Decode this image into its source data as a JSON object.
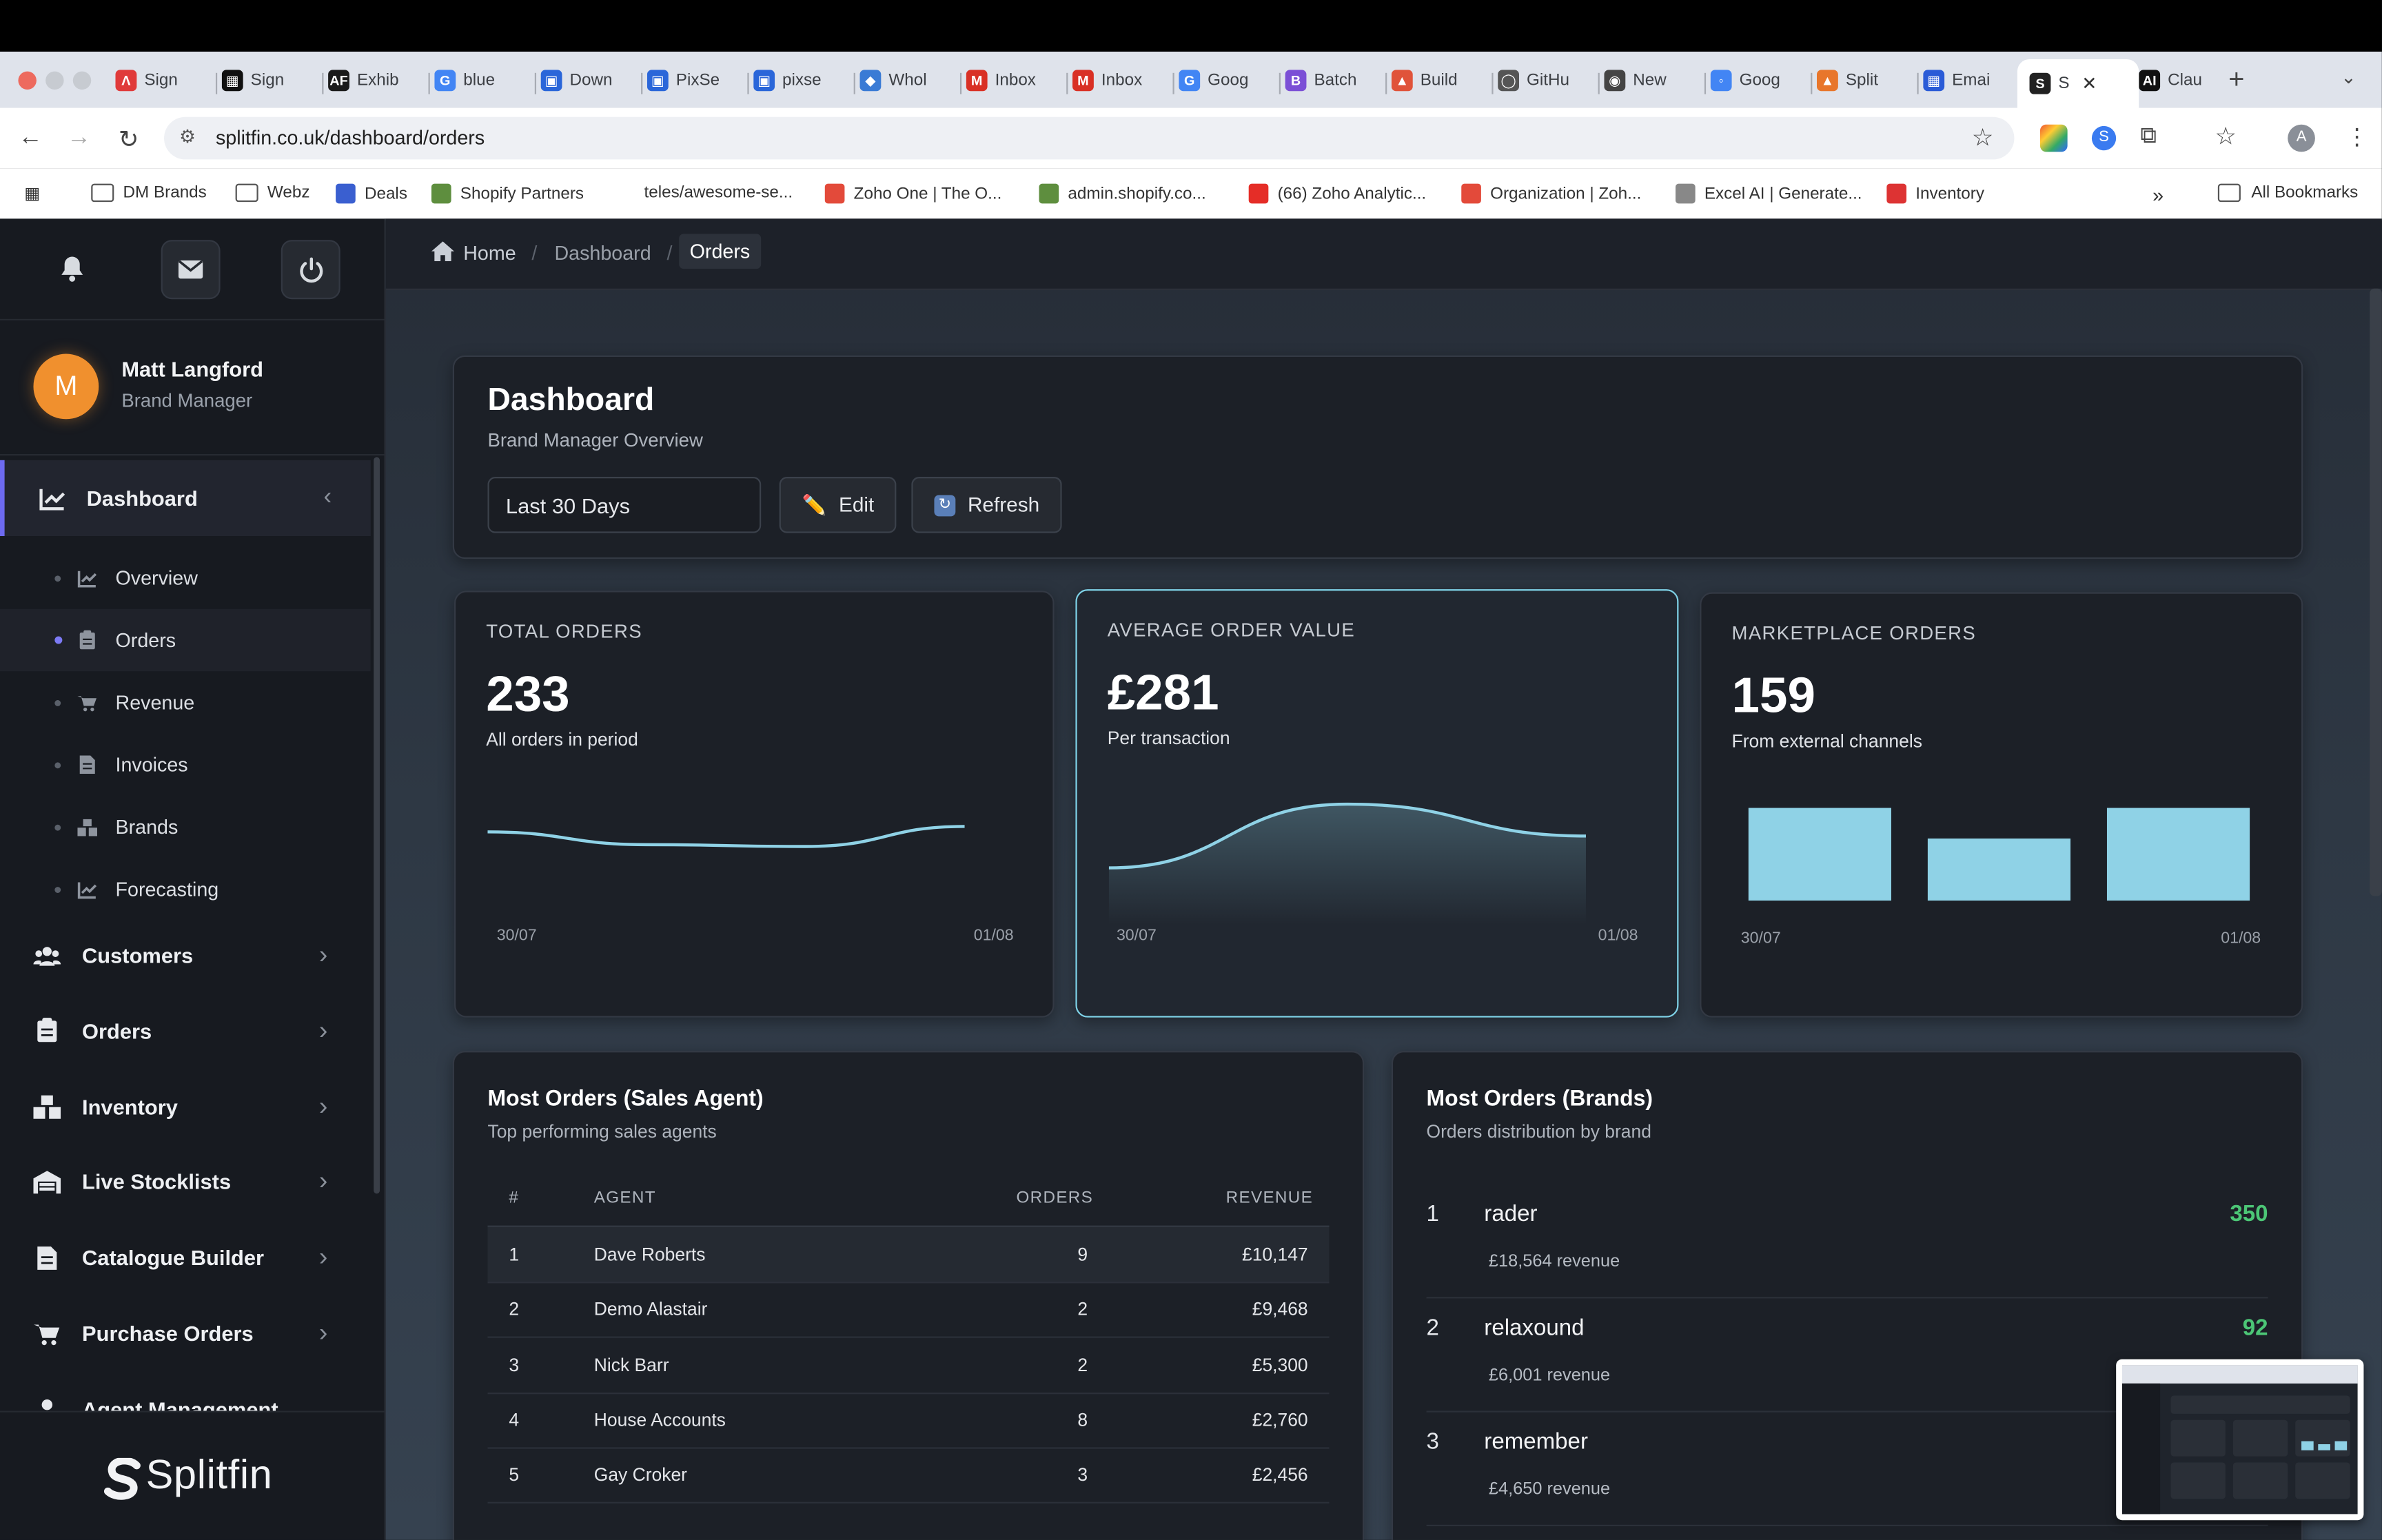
{
  "browser": {
    "tabs": [
      {
        "label": "Sign",
        "fav_color": "#e03a3a",
        "fav_glyph": "Λ"
      },
      {
        "label": "Sign",
        "fav_color": "#111111",
        "fav_glyph": "▦"
      },
      {
        "label": "Exhib",
        "fav_color": "#1a1a1a",
        "fav_glyph": "AF"
      },
      {
        "label": "blue",
        "fav_color": "#4285f4",
        "fav_glyph": "G"
      },
      {
        "label": "Down",
        "fav_color": "#2a66d9",
        "fav_glyph": "▣"
      },
      {
        "label": "PixSe",
        "fav_color": "#2a66d9",
        "fav_glyph": "▣"
      },
      {
        "label": "pixse",
        "fav_color": "#2a66d9",
        "fav_glyph": "▣"
      },
      {
        "label": "Whol",
        "fav_color": "#3a7bd5",
        "fav_glyph": "◆"
      },
      {
        "label": "Inbox",
        "fav_color": "#d93025",
        "fav_glyph": "M"
      },
      {
        "label": "Inbox",
        "fav_color": "#d93025",
        "fav_glyph": "M"
      },
      {
        "label": "Goog",
        "fav_color": "#4285f4",
        "fav_glyph": "G"
      },
      {
        "label": "Batch",
        "fav_color": "#7b4fd6",
        "fav_glyph": "B"
      },
      {
        "label": "Build",
        "fav_color": "#e0533a",
        "fav_glyph": "▲"
      },
      {
        "label": "GitHu",
        "fav_color": "#555555",
        "fav_glyph": "◯"
      },
      {
        "label": "New",
        "fav_color": "#444444",
        "fav_glyph": "◉"
      },
      {
        "label": "Goog",
        "fav_color": "#4285f4",
        "fav_glyph": "◦"
      },
      {
        "label": "Split",
        "fav_color": "#e8762b",
        "fav_glyph": "▲"
      },
      {
        "label": "Emai",
        "fav_color": "#2a5bd7",
        "fav_glyph": "▦"
      },
      {
        "label": "S",
        "fav_color": "#222222",
        "fav_glyph": "S",
        "active": true
      },
      {
        "label": "Clau",
        "fav_color": "#111111",
        "fav_glyph": "AI"
      }
    ],
    "url": "splitfin.co.uk/dashboard/orders",
    "bookmarks": [
      {
        "label": "DM Brands",
        "icon": "folder-icon"
      },
      {
        "label": "Webz",
        "icon": "folder-icon"
      },
      {
        "label": "Deals",
        "icon": "deals-icon"
      },
      {
        "label": "Shopify Partners",
        "icon": "shopify-icon"
      },
      {
        "label": "teles/awesome-se...",
        "icon": "none"
      },
      {
        "label": "Zoho One | The O...",
        "icon": "zoho-icon"
      },
      {
        "label": "admin.shopify.co...",
        "icon": "shopify-icon"
      },
      {
        "label": "(66) Zoho Analytic...",
        "icon": "youtube-icon"
      },
      {
        "label": "Organization | Zoh...",
        "icon": "zoho-icon"
      },
      {
        "label": "Excel AI | Generate...",
        "icon": "excel-icon"
      },
      {
        "label": "Inventory",
        "icon": "inventory-icon"
      }
    ],
    "all_bookmarks": "All Bookmarks",
    "profile_initial": "A"
  },
  "user": {
    "initial": "M",
    "name": "Matt Langford",
    "role": "Brand Manager"
  },
  "sidebar": {
    "dashboard": {
      "label": "Dashboard",
      "chevron": "‹"
    },
    "subitems": [
      {
        "label": "Overview",
        "icon": "chart-icon"
      },
      {
        "label": "Orders",
        "icon": "clipboard-icon",
        "active": true
      },
      {
        "label": "Revenue",
        "icon": "cart-icon"
      },
      {
        "label": "Invoices",
        "icon": "document-icon"
      },
      {
        "label": "Brands",
        "icon": "boxes-icon"
      },
      {
        "label": "Forecasting",
        "icon": "chart-icon"
      }
    ],
    "items": [
      {
        "label": "Customers",
        "icon": "users-icon",
        "chevron": "›"
      },
      {
        "label": "Orders",
        "icon": "clipboard-icon",
        "chevron": "›"
      },
      {
        "label": "Inventory",
        "icon": "boxes-icon",
        "chevron": "›"
      },
      {
        "label": "Live Stocklists",
        "icon": "warehouse-icon",
        "chevron": "›"
      },
      {
        "label": "Catalogue Builder",
        "icon": "document-icon",
        "chevron": "›"
      },
      {
        "label": "Purchase Orders",
        "icon": "cart-icon",
        "chevron": "›"
      },
      {
        "label": "Agent Management",
        "icon": "user-icon",
        "chevron": ""
      }
    ],
    "brand": "Splitfin"
  },
  "breadcrumb": {
    "home": "Home",
    "dashboard": "Dashboard",
    "current": "Orders"
  },
  "header": {
    "title": "Dashboard",
    "subtitle": "Brand Manager Overview",
    "range": "Last 30 Days",
    "edit_label": "Edit",
    "refresh_label": "Refresh"
  },
  "kpis": [
    {
      "label": "TOTAL ORDERS",
      "value": "233",
      "sub": "All orders in period",
      "x_start": "30/07",
      "x_end": "01/08"
    },
    {
      "label": "AVERAGE ORDER VALUE",
      "value": "£281",
      "sub": "Per transaction",
      "x_start": "30/07",
      "x_end": "01/08"
    },
    {
      "label": "MARKETPLACE ORDERS",
      "value": "159",
      "sub": "From external channels",
      "x_start": "30/07",
      "x_end": "01/08"
    }
  ],
  "chart_data": [
    {
      "type": "line",
      "name": "total-orders-sparkline",
      "values": [
        0.62,
        0.48,
        0.46,
        0.68
      ]
    },
    {
      "type": "area",
      "name": "avg-order-value-sparkline",
      "values": [
        0.25,
        0.85,
        0.55
      ]
    },
    {
      "type": "bar",
      "name": "marketplace-orders-bars",
      "values": [
        1.0,
        0.67,
        1.0
      ],
      "color": "#8fd2e6"
    }
  ],
  "agents": {
    "title": "Most Orders (Sales Agent)",
    "subtitle": "Top performing sales agents",
    "columns": [
      "#",
      "AGENT",
      "ORDERS",
      "REVENUE"
    ],
    "rows": [
      {
        "rank": "1",
        "agent": "Dave Roberts",
        "orders": "9",
        "revenue": "£10,147"
      },
      {
        "rank": "2",
        "agent": "Demo Alastair",
        "orders": "2",
        "revenue": "£9,468"
      },
      {
        "rank": "3",
        "agent": "Nick Barr",
        "orders": "2",
        "revenue": "£5,300"
      },
      {
        "rank": "4",
        "agent": "House Accounts",
        "orders": "8",
        "revenue": "£2,760"
      },
      {
        "rank": "5",
        "agent": "Gay Croker",
        "orders": "3",
        "revenue": "£2,456"
      }
    ]
  },
  "brands": {
    "title": "Most Orders (Brands)",
    "subtitle": "Orders distribution by brand",
    "rows": [
      {
        "rank": "1",
        "name": "rader",
        "revenue": "£18,564 revenue",
        "count": "350"
      },
      {
        "rank": "2",
        "name": "relaxound",
        "revenue": "£6,001 revenue",
        "count": "92"
      },
      {
        "rank": "3",
        "name": "remember",
        "revenue": "£4,650 revenue",
        "count": ""
      }
    ]
  }
}
